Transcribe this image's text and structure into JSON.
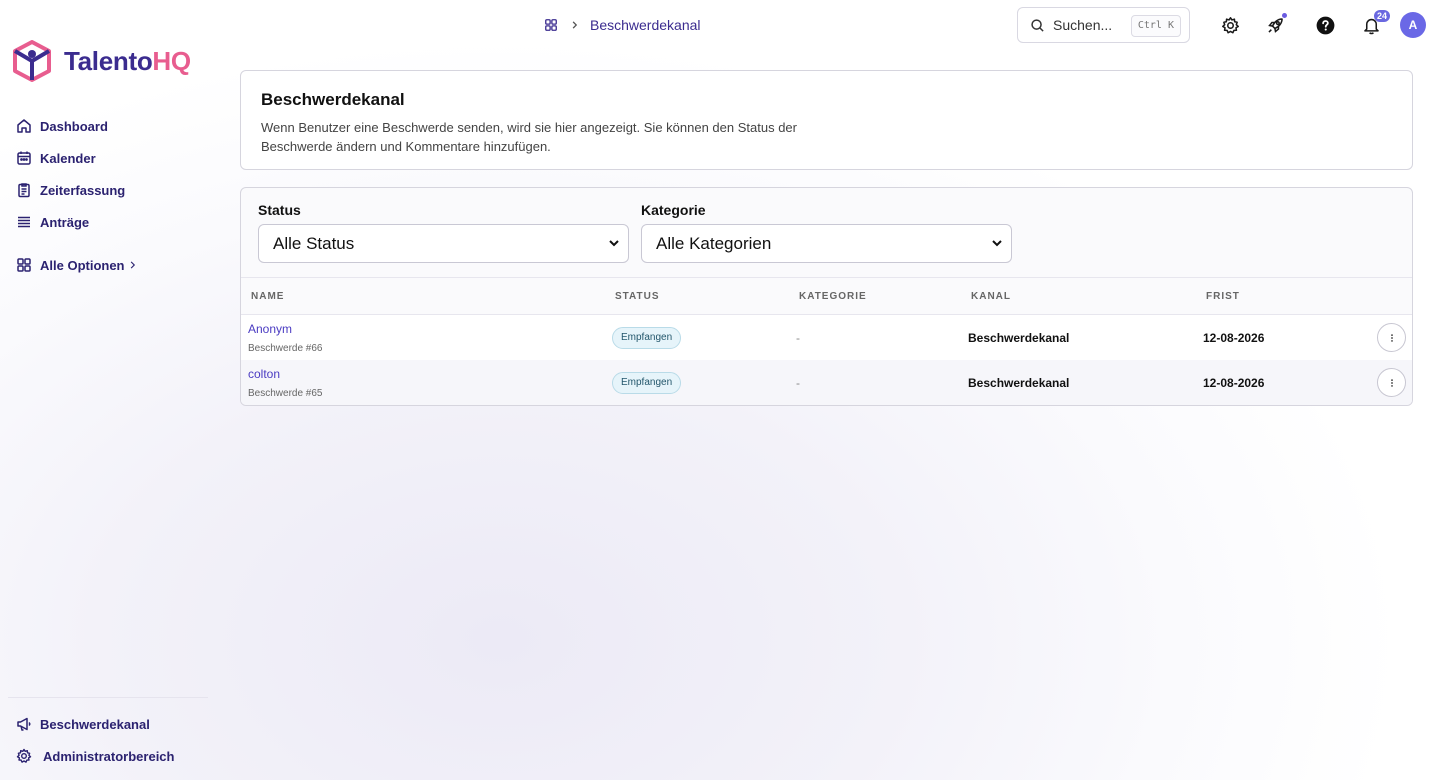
{
  "app": {
    "brand_part1": "Talento",
    "brand_part2": "HQ",
    "brand_color": "#3b2c8f",
    "brand_accent": "#e85d8f"
  },
  "sidebar": {
    "items": [
      {
        "label": "Dashboard",
        "icon": "home-icon"
      },
      {
        "label": "Kalender",
        "icon": "calendar-icon"
      },
      {
        "label": "Zeiterfassung",
        "icon": "clipboard-icon"
      },
      {
        "label": "Anträge",
        "icon": "list-icon"
      }
    ],
    "more_label": "Alle Optionen",
    "bottom_items": [
      {
        "label": "Beschwerdekanal",
        "icon": "megaphone-icon"
      },
      {
        "label": "Administratorbereich",
        "icon": "gear-icon"
      }
    ]
  },
  "topbar": {
    "breadcrumb_current": "Beschwerdekanal",
    "search_placeholder": "Suchen...",
    "search_shortcut": "Ctrl K",
    "notification_count": "24",
    "avatar_initial": "A"
  },
  "page": {
    "title": "Beschwerdekanal",
    "description": "Wenn Benutzer eine Beschwerde senden, wird sie hier angezeigt. Sie können den Status der Beschwerde ändern und Kommentare hinzufügen."
  },
  "filters": {
    "status_label": "Status",
    "status_value": "Alle Status",
    "category_label": "Kategorie",
    "category_value": "Alle Kategorien"
  },
  "table": {
    "columns": [
      "NAME",
      "STATUS",
      "KATEGORIE",
      "KANAL",
      "FRIST"
    ],
    "rows": [
      {
        "name": "Anonym",
        "sub": "Beschwerde #66",
        "status": "Empfangen",
        "category": "-",
        "channel": "Beschwerdekanal",
        "deadline": "12-08-2026"
      },
      {
        "name": "colton",
        "sub": "Beschwerde #65",
        "status": "Empfangen",
        "category": "-",
        "channel": "Beschwerdekanal",
        "deadline": "12-08-2026"
      }
    ]
  }
}
